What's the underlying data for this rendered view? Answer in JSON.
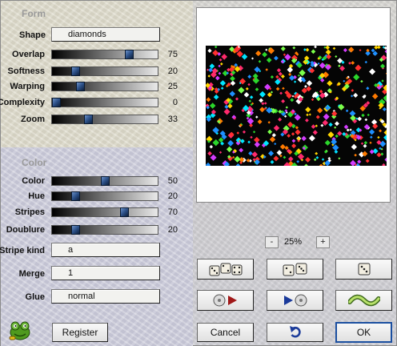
{
  "form": {
    "title": "Form",
    "shape": {
      "label": "Shape",
      "value": "diamonds"
    },
    "sliders": [
      {
        "key": "overlap",
        "label": "Overlap",
        "value": "75",
        "level": 0.75
      },
      {
        "key": "softness",
        "label": "Softness",
        "value": "20",
        "level": 0.2
      },
      {
        "key": "warping",
        "label": "Warping",
        "value": "25",
        "level": 0.25
      },
      {
        "key": "complexity",
        "label": "Complexity",
        "value": "0",
        "level": 0.0
      },
      {
        "key": "zoom",
        "label": "Zoom",
        "value": "33",
        "level": 0.33
      }
    ]
  },
  "color": {
    "title": "Color",
    "sliders": [
      {
        "key": "color",
        "label": "Color",
        "value": "50",
        "level": 0.5
      },
      {
        "key": "hue",
        "label": "Hue",
        "value": "20",
        "level": 0.2
      },
      {
        "key": "stripes",
        "label": "Stripes",
        "value": "70",
        "level": 0.7
      },
      {
        "key": "doublure",
        "label": "Doublure",
        "value": "20",
        "level": 0.2
      }
    ],
    "stripe_kind": {
      "label": "Stripe kind",
      "value": "a"
    },
    "merge": {
      "label": "Merge",
      "value": "1"
    },
    "glue": {
      "label": "Glue",
      "value": "normal"
    }
  },
  "preview": {
    "zoom": "25%",
    "zoom_out": "-",
    "zoom_in": "+"
  },
  "buttons": {
    "register": "Register",
    "cancel": "Cancel",
    "ok": "OK"
  },
  "icons": {
    "logo": "green-frog-mascot-icon",
    "random_all": "three-dice-icon",
    "random_some": "two-dice-icon",
    "random_one": "one-die-icon",
    "load": "load-preset-icon",
    "save": "save-preset-icon",
    "undo": "undo-arrow-icon",
    "wave": "wave-icon"
  }
}
